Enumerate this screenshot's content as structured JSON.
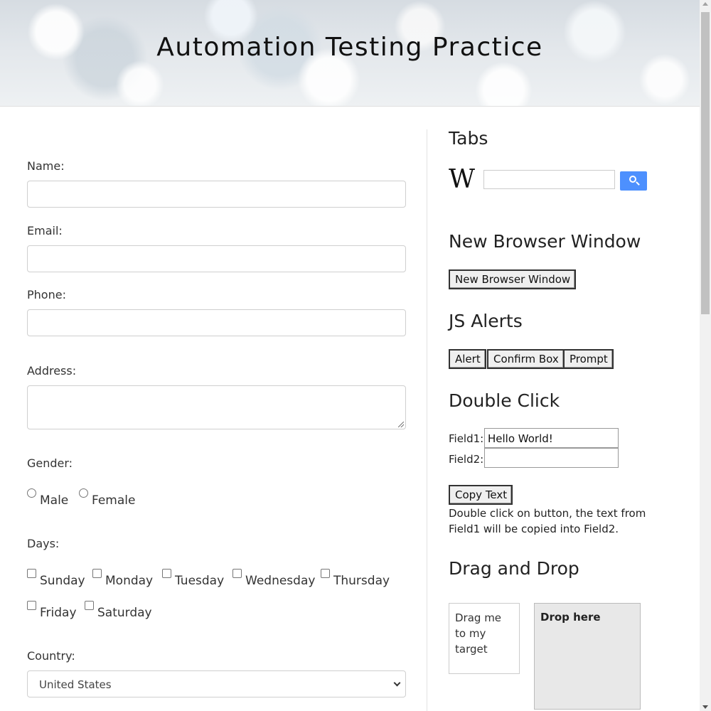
{
  "header": {
    "title": "Automation Testing Practice"
  },
  "form": {
    "name_label": "Name:",
    "email_label": "Email:",
    "phone_label": "Phone:",
    "address_label": "Address:",
    "gender_label": "Gender:",
    "gender_options": [
      "Male",
      "Female"
    ],
    "days_label": "Days:",
    "days": [
      "Sunday",
      "Monday",
      "Tuesday",
      "Wednesday",
      "Thursday",
      "Friday",
      "Saturday"
    ],
    "country_label": "Country:",
    "country_value": "United States"
  },
  "tabs": {
    "heading": "Tabs",
    "wiki_logo": "W"
  },
  "new_window": {
    "heading": "New Browser Window",
    "button": "New Browser Window"
  },
  "alerts": {
    "heading": "JS Alerts",
    "alert": "Alert",
    "confirm": "Confirm Box",
    "prompt": "Prompt"
  },
  "double_click": {
    "heading": "Double Click",
    "field1_label": "Field1:",
    "field1_value": "Hello World!",
    "field2_label": "Field2:",
    "field2_value": "",
    "button": "Copy Text",
    "note": "Double click on button, the text from Field1 will be copied into Field2."
  },
  "drag_drop": {
    "heading": "Drag and Drop",
    "draggable": "Drag me to my target",
    "droppable": "Drop here"
  },
  "colors": {
    "search_button": "#4d90fe",
    "drop_bg": "#e8e8e8"
  }
}
